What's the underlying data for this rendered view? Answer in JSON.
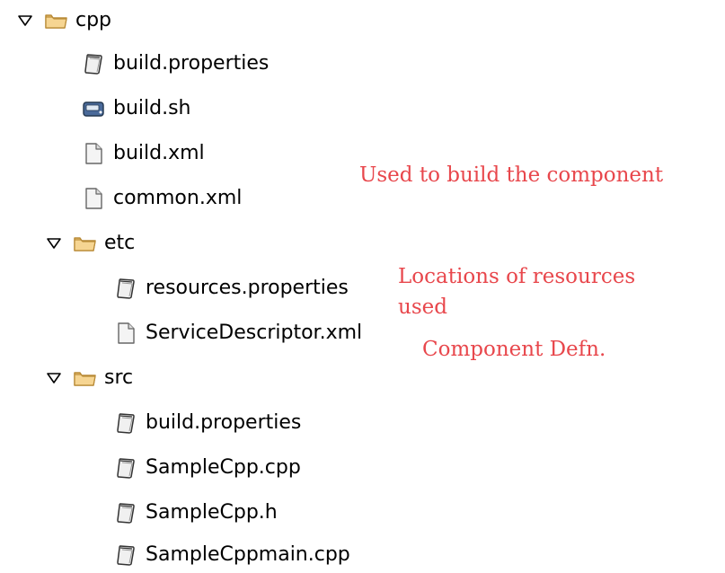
{
  "tree": {
    "root": {
      "label": "cpp",
      "icon": "folder-open-icon"
    },
    "children": [
      {
        "label": "build.properties",
        "icon": "properties-file-icon"
      },
      {
        "label": "build.sh",
        "icon": "shell-script-icon"
      },
      {
        "label": "build.xml",
        "icon": "generic-file-icon"
      },
      {
        "label": "common.xml",
        "icon": "generic-file-icon"
      }
    ],
    "etc": {
      "label": "etc",
      "icon": "folder-open-icon",
      "children": [
        {
          "label": "resources.properties",
          "icon": "properties-file-icon"
        },
        {
          "label": "ServiceDescriptor.xml",
          "icon": "generic-file-icon"
        }
      ]
    },
    "src": {
      "label": "src",
      "icon": "folder-open-icon",
      "children": [
        {
          "label": "build.properties",
          "icon": "properties-file-icon"
        },
        {
          "label": "SampleCpp.cpp",
          "icon": "properties-file-icon"
        },
        {
          "label": "SampleCpp.h",
          "icon": "properties-file-icon"
        },
        {
          "label": "SampleCppmain.cpp",
          "icon": "properties-file-icon"
        }
      ]
    }
  },
  "annotations": {
    "build": "Used to build the component",
    "resources_line1": "Locations of resources",
    "resources_line2": "used",
    "component": "Component Defn."
  },
  "colors": {
    "annotation": "#e8474c",
    "folder": "#f2c77a",
    "folder_stroke": "#b88a36"
  }
}
